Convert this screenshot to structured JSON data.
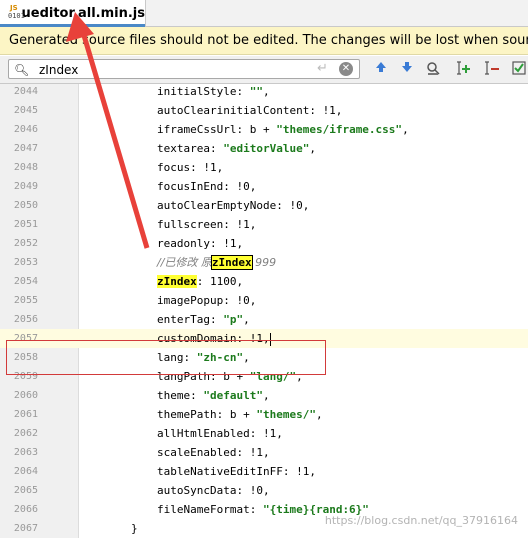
{
  "tab": {
    "title": "ueditor.all.min.js",
    "icon": "js-file-icon"
  },
  "banner": {
    "text": "Generated source files should not be edited. The changes will be lost when sources are r"
  },
  "search": {
    "value": "zIndex",
    "placeholder": ""
  },
  "code_lines": [
    {
      "num": "2044",
      "parts": [
        {
          "t": "initialStyle: ",
          "c": ""
        },
        {
          "t": "\"\"",
          "c": "str"
        },
        {
          "t": ",",
          "c": ""
        }
      ]
    },
    {
      "num": "2045",
      "parts": [
        {
          "t": "autoClearinitialContent: !1,",
          "c": ""
        }
      ]
    },
    {
      "num": "2046",
      "parts": [
        {
          "t": "iframeCssUrl: b + ",
          "c": ""
        },
        {
          "t": "\"themes/iframe.css\"",
          "c": "str"
        },
        {
          "t": ",",
          "c": ""
        }
      ]
    },
    {
      "num": "2047",
      "parts": [
        {
          "t": "textarea: ",
          "c": ""
        },
        {
          "t": "\"editorValue\"",
          "c": "str"
        },
        {
          "t": ",",
          "c": ""
        }
      ]
    },
    {
      "num": "2048",
      "parts": [
        {
          "t": "focus: !1,",
          "c": ""
        }
      ]
    },
    {
      "num": "2049",
      "parts": [
        {
          "t": "focusInEnd: !0,",
          "c": ""
        }
      ]
    },
    {
      "num": "2050",
      "parts": [
        {
          "t": "autoClearEmptyNode: !0,",
          "c": ""
        }
      ]
    },
    {
      "num": "2051",
      "parts": [
        {
          "t": "fullscreen: !1,",
          "c": ""
        }
      ]
    },
    {
      "num": "2052",
      "parts": [
        {
          "t": "readonly: !1,",
          "c": ""
        }
      ]
    },
    {
      "num": "2053",
      "parts": [
        {
          "t": "//已修改 原",
          "c": "cmt"
        },
        {
          "t": "zIndex",
          "c": "hl hlbox"
        },
        {
          "t": " 999",
          "c": "cmt"
        }
      ]
    },
    {
      "num": "2054",
      "parts": [
        {
          "t": "zIndex",
          "c": "hl"
        },
        {
          "t": ": 1100,",
          "c": ""
        }
      ]
    },
    {
      "num": "2055",
      "parts": [
        {
          "t": "imagePopup: !0,",
          "c": ""
        }
      ]
    },
    {
      "num": "2056",
      "parts": [
        {
          "t": "enterTag: ",
          "c": ""
        },
        {
          "t": "\"p\"",
          "c": "str"
        },
        {
          "t": ",",
          "c": ""
        }
      ]
    },
    {
      "num": "2057",
      "parts": [
        {
          "t": "customDomain: !1,",
          "c": ""
        }
      ],
      "current": true
    },
    {
      "num": "2058",
      "parts": [
        {
          "t": "lang: ",
          "c": ""
        },
        {
          "t": "\"zh-cn\"",
          "c": "str"
        },
        {
          "t": ",",
          "c": ""
        }
      ]
    },
    {
      "num": "2059",
      "parts": [
        {
          "t": "langPath: b + ",
          "c": ""
        },
        {
          "t": "\"lang/\"",
          "c": "str"
        },
        {
          "t": ",",
          "c": ""
        }
      ]
    },
    {
      "num": "2060",
      "parts": [
        {
          "t": "theme: ",
          "c": ""
        },
        {
          "t": "\"default\"",
          "c": "str"
        },
        {
          "t": ",",
          "c": ""
        }
      ]
    },
    {
      "num": "2061",
      "parts": [
        {
          "t": "themePath: b + ",
          "c": ""
        },
        {
          "t": "\"themes/\"",
          "c": "str"
        },
        {
          "t": ",",
          "c": ""
        }
      ]
    },
    {
      "num": "2062",
      "parts": [
        {
          "t": "allHtmlEnabled: !1,",
          "c": ""
        }
      ]
    },
    {
      "num": "2063",
      "parts": [
        {
          "t": "scaleEnabled: !1,",
          "c": ""
        }
      ]
    },
    {
      "num": "2064",
      "parts": [
        {
          "t": "tableNativeEditInFF: !1,",
          "c": ""
        }
      ]
    },
    {
      "num": "2065",
      "parts": [
        {
          "t": "autoSyncData: !0,",
          "c": ""
        }
      ]
    },
    {
      "num": "2066",
      "parts": [
        {
          "t": "fileNameFormat: ",
          "c": ""
        },
        {
          "t": "\"{time}{rand:6}\"",
          "c": "str"
        }
      ]
    },
    {
      "num": "2067",
      "parts": [
        {
          "t": "}",
          "c": ""
        }
      ],
      "indent": "outer"
    }
  ],
  "watermark": "https://blog.csdn.net/qq_37916164",
  "colors": {
    "banner_bg": "#fcf5c5",
    "highlight": "#ffff33",
    "string": "#1c7a1c",
    "annotation": "#d23a3a"
  }
}
